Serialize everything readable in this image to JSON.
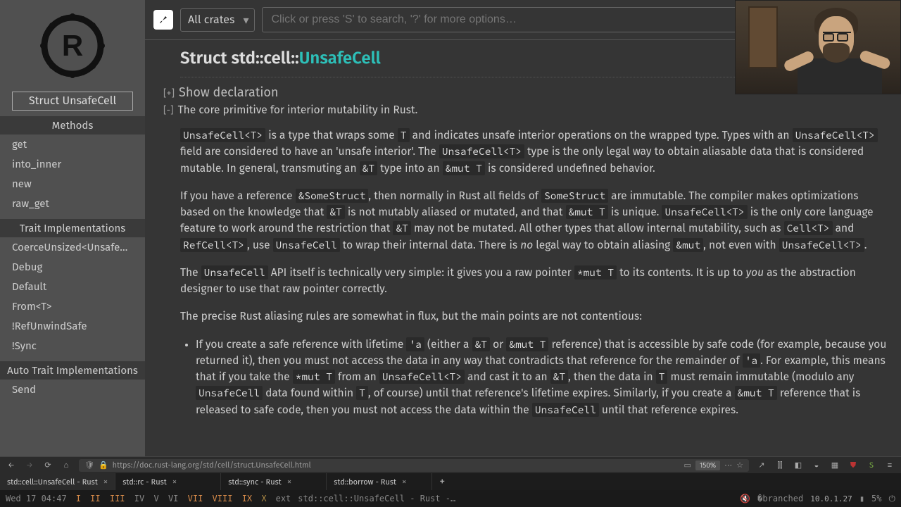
{
  "topbar": {
    "crate_select": "All crates",
    "search_placeholder": "Click or press 'S' to search, '?' for more options…"
  },
  "sidebar": {
    "struct_badge": "Struct UnsafeCell",
    "methods_h": "Methods",
    "methods": [
      "get",
      "into_inner",
      "new",
      "raw_get"
    ],
    "traits_h": "Trait Implementations",
    "traits": [
      "CoerceUnsized<UnsafeCell…",
      "Debug",
      "Default",
      "From<T>",
      "!RefUnwindSafe",
      "!Sync"
    ],
    "auto_h": "Auto Trait Implementations",
    "auto": [
      "Send"
    ]
  },
  "title": {
    "prefix": "Struct ",
    "path": "std::cell::",
    "name": "UnsafeCell"
  },
  "toggle_open": "[+]",
  "toggle_close": "[-]",
  "declaration": "Show declaration",
  "summary": "The core primitive for interior mutability in Rust.",
  "para1": {
    "t1": " is a type that wraps some ",
    "t2": " and indicates unsafe interior operations on the wrapped type. Types with an ",
    "t3": " field are considered to have an 'unsafe interior'. The ",
    "t4": " type is the only legal way to obtain aliasable data that is considered mutable. In general, transmuting an ",
    "t5": " type into an ",
    "t6": " is considered undefined behavior."
  },
  "para2": {
    "t1": "If you have a reference ",
    "t2": ", then normally in Rust all fields of ",
    "t3": " are immutable. The compiler makes optimizations based on the knowledge that ",
    "t4": " is not mutably aliased or mutated, and that ",
    "t5": " is unique. ",
    "t6": " is the only core language feature to work around the restriction that ",
    "t7": " may not be mutated. All other types that allow internal mutability, such as ",
    "tand": " and ",
    "t8": ", use ",
    "t9": " to wrap their internal data. There is ",
    "no": "no",
    "t10": " legal way to obtain aliasing ",
    "t11": ", not even with ",
    "t12": "."
  },
  "para3": {
    "t1": "The ",
    "t2": " API itself is technically very simple: it gives you a raw pointer ",
    "t3": " to its contents. It is up to ",
    "you": "you",
    "t4": " as the abstraction designer to use that raw pointer correctly."
  },
  "para4": "The precise Rust aliasing rules are somewhat in flux, but the main points are not contentious:",
  "bullet1": {
    "t1": "If you create a safe reference with lifetime ",
    "t2": " (either a ",
    "t3": " or ",
    "t4": " reference) that is accessible by safe code (for example, because you returned it), then you must not access the data in any way that contradicts that reference for the remainder of ",
    "t5": ". For example, this means that if you take the ",
    "t6": " from an ",
    "t7": " and cast it to an ",
    "t8": ", then the data in ",
    "t9": " must remain immutable (modulo any ",
    "t10": " data found within ",
    "t11": ", of course) until that reference's lifetime expires. Similarly, if you create a ",
    "t12": " reference that is released to safe code, then you must not access the data within the ",
    "t13": " until that reference expires."
  },
  "codes": {
    "uct": "UnsafeCell<T>",
    "T": "T",
    "ampT": "&T",
    "ampmutT": "&mut T",
    "someStructRef": "&SomeStruct",
    "someStruct": "SomeStruct",
    "cellT": "Cell<T>",
    "refCellT": "RefCell<T>",
    "unsafe": "UnsafeCell",
    "ampmut": "&mut",
    "starmutT": "*mut T",
    "tickA": "'a"
  },
  "browser": {
    "url": "https://doc.rust-lang.org/std/cell/struct.UnsafeCell.html",
    "zoom": "150%",
    "ip": "10.0.1.27",
    "pct": "5%"
  },
  "tabs": [
    {
      "label": "std::cell::UnsafeCell - Rust",
      "active": true
    },
    {
      "label": "std::rc - Rust",
      "active": false
    },
    {
      "label": "std::sync - Rust",
      "active": false
    },
    {
      "label": "std::borrow - Rust",
      "active": false
    }
  ],
  "status": {
    "date": "Wed 17 04:47",
    "ws": [
      "I",
      "II",
      "III",
      "IV",
      "V",
      "VI",
      "VII",
      "VIII",
      "IX",
      "X"
    ],
    "ext": "ext",
    "title": "std::cell::UnsafeCell - Rust -…"
  }
}
